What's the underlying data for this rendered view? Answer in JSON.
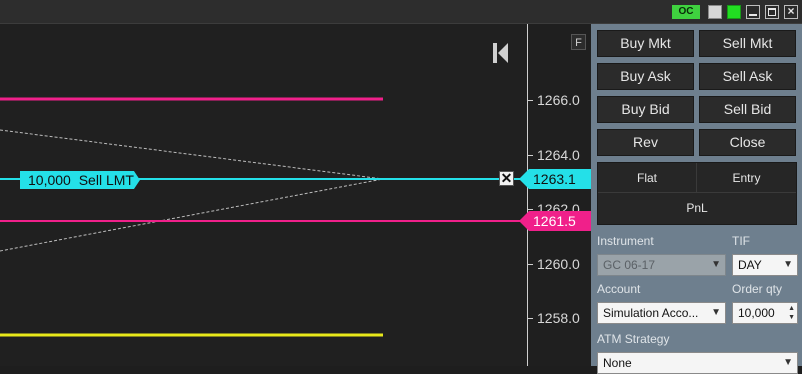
{
  "titlebar": {
    "oc_badge": "OC"
  },
  "chart": {
    "f_button": "F",
    "price_axis": {
      "ticks": [
        "1266.0",
        "1264.0",
        "1262.0",
        "1260.0",
        "1258.0"
      ]
    },
    "order": {
      "quantity": "10,000",
      "type": "Sell LMT",
      "price_tag": "1263.1",
      "close_glyph": "✕"
    },
    "last_price_tag": "1261.5",
    "colors": {
      "order_line": "#24e0e8",
      "pink_line": "#f0208a",
      "yellow_line": "#e8e81a",
      "background": "#202020"
    }
  },
  "order_panel": {
    "buttons": {
      "buy_mkt": "Buy Mkt",
      "sell_mkt": "Sell Mkt",
      "buy_ask": "Buy Ask",
      "sell_ask": "Sell Ask",
      "buy_bid": "Buy Bid",
      "sell_bid": "Sell Bid",
      "rev": "Rev",
      "close": "Close"
    },
    "position": {
      "flat": "Flat",
      "entry": "Entry",
      "pnl": "PnL"
    },
    "instrument": {
      "label": "Instrument",
      "value": "GC 06-17"
    },
    "tif": {
      "label": "TIF",
      "value": "DAY"
    },
    "account": {
      "label": "Account",
      "value": "Simulation Acco..."
    },
    "order_qty": {
      "label": "Order qty",
      "value": "10,000"
    },
    "atm_strategy": {
      "label": "ATM Strategy",
      "value": "None"
    }
  }
}
